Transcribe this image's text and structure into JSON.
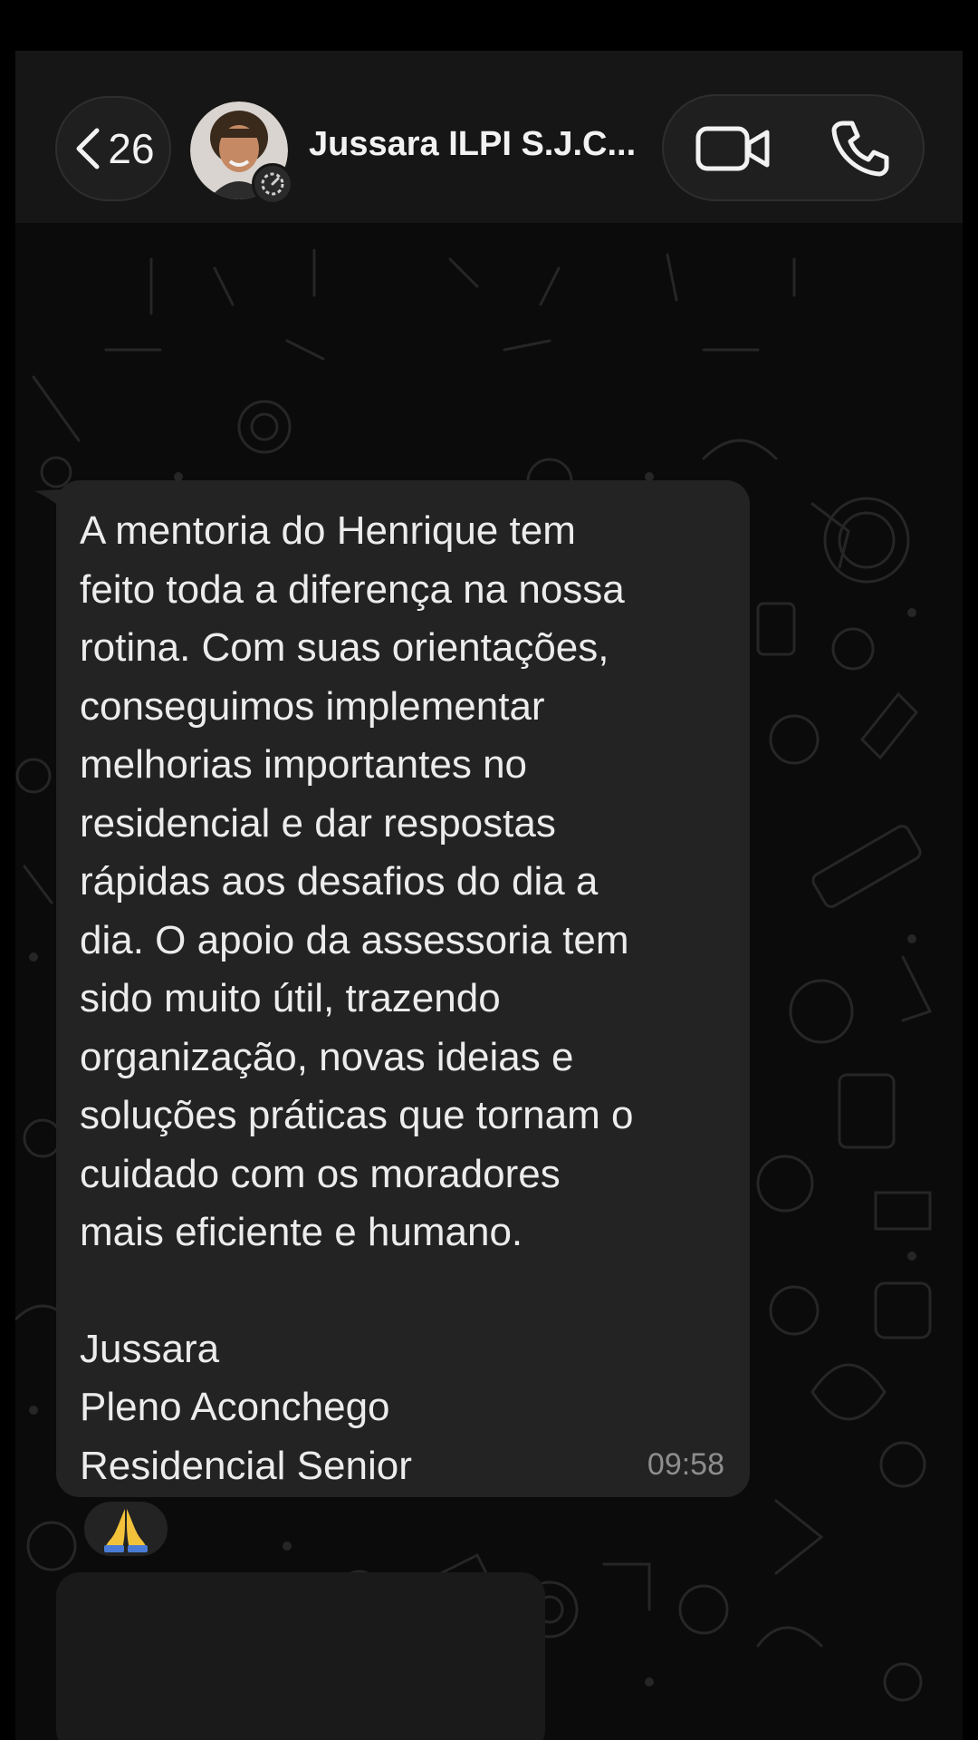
{
  "header": {
    "back_count": "26",
    "contact_name": "Jussara ILPI S.J.C...",
    "avatar_icon": "contact-photo",
    "video_icon": "video-camera-icon",
    "phone_icon": "phone-icon"
  },
  "message": {
    "body": "A mentoria do Henrique tem\nfeito toda a diferença na nossa\nrotina. Com suas orientações,\nconseguimos implementar\nmelhorias importantes no\nresidencial e dar respostas\nrápidas aos desafios do dia a\ndia. O apoio da assessoria tem\nsido muito útil, trazendo\norganização, novas ideias e\nsoluções práticas que tornam o\ncuidado com os moradores\nmais eficiente e humano.",
    "signature": {
      "line1": "Jussara",
      "line2": "Pleno Aconchego",
      "line3": "Residencial Senior"
    },
    "time": "09:58",
    "reaction": "🙏"
  },
  "colors": {
    "background": "#0b0b0b",
    "header": "#161616",
    "bubble": "#232323",
    "text": "#ececec",
    "timestamp": "#8e8e8e"
  }
}
